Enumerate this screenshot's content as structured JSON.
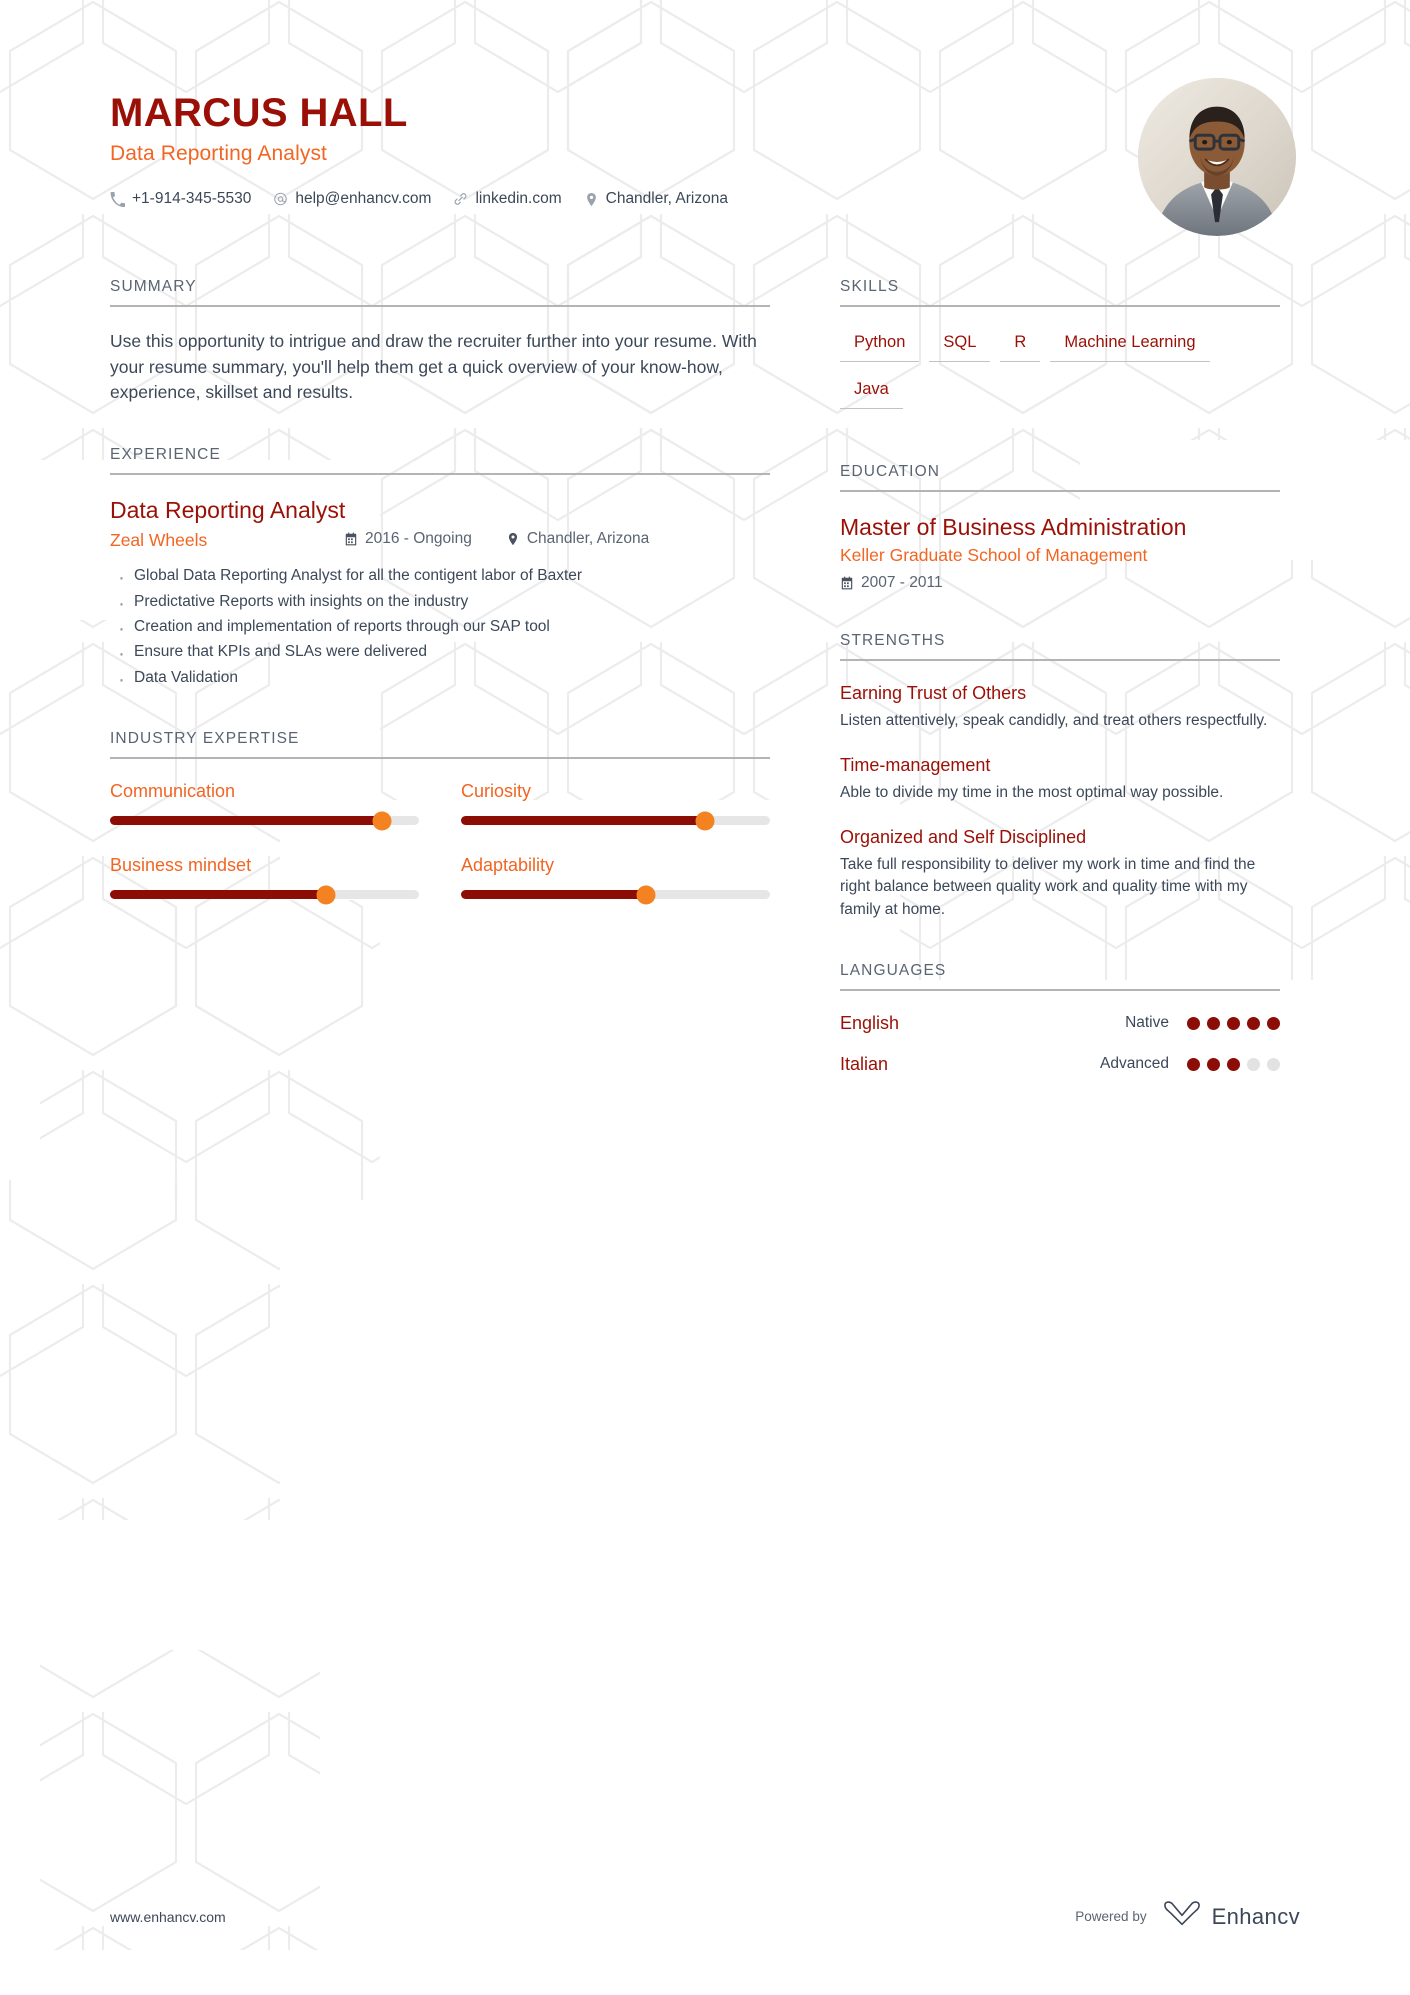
{
  "accent": {
    "dark_red": "#9b1006",
    "orange": "#f26522",
    "slider_fill": "#8c0d05",
    "slider_thumb": "#f58220",
    "body_text": "#3c4858",
    "rule": "#b4b4b4"
  },
  "header": {
    "name": "MARCUS HALL",
    "job_title": "Data Reporting Analyst",
    "avatar_alt": "portrait-photo",
    "contacts": [
      {
        "icon": "phone-icon",
        "text": "+1-914-345-5530"
      },
      {
        "icon": "email-icon",
        "text": "help@enhancv.com"
      },
      {
        "icon": "link-icon",
        "text": "linkedin.com"
      },
      {
        "icon": "location-pin-icon",
        "text": "Chandler, Arizona"
      }
    ]
  },
  "summary": {
    "heading": "SUMMARY",
    "text": "Use this opportunity to intrigue and draw the recruiter further into your resume. With your resume summary, you'll help them get a quick overview of your know-how, experience, skillset and results."
  },
  "experience": {
    "heading": "EXPERIENCE",
    "items": [
      {
        "title": "Data Reporting Analyst",
        "company": "Zeal Wheels",
        "date": "2016 - Ongoing",
        "location": "Chandler, Arizona",
        "bullets": [
          "Global Data Reporting Analyst for all the contigent labor of Baxter",
          "Predictative Reports with insights on the industry",
          "Creation and implementation of reports through our SAP tool",
          "Ensure that KPIs and SLAs were delivered",
          "Data Validation"
        ]
      }
    ]
  },
  "industry_expertise": {
    "heading": "INDUSTRY EXPERTISE",
    "items": [
      {
        "label": "Communication",
        "value": 88
      },
      {
        "label": "Curiosity",
        "value": 79
      },
      {
        "label": "Business mindset",
        "value": 70
      },
      {
        "label": "Adaptability",
        "value": 60
      }
    ]
  },
  "skills": {
    "heading": "SKILLS",
    "items": [
      "Python",
      "SQL",
      "R",
      "Machine Learning",
      "Java"
    ]
  },
  "education": {
    "heading": "EDUCATION",
    "items": [
      {
        "degree": "Master of Business Administration",
        "school": "Keller Graduate School of Management",
        "date": "2007 - 2011"
      }
    ]
  },
  "strengths": {
    "heading": "STRENGTHS",
    "items": [
      {
        "title": "Earning Trust of Others",
        "description": "Listen attentively, speak candidly, and treat others respectfully."
      },
      {
        "title": "Time-management",
        "description": "Able to divide my time in the most optimal way possible."
      },
      {
        "title": "Organized and Self Disciplined",
        "description": "Take full responsibility to deliver my work in time and find the right balance between quality work and quality time with my family at home."
      }
    ]
  },
  "languages": {
    "heading": "LANGUAGES",
    "items": [
      {
        "name": "English",
        "level": "Native",
        "filled": 5,
        "total": 5
      },
      {
        "name": "Italian",
        "level": "Advanced",
        "filled": 3,
        "total": 5
      }
    ]
  },
  "footer": {
    "url": "www.enhancv.com",
    "powered_by": "Powered by",
    "brand": "Enhancv"
  }
}
